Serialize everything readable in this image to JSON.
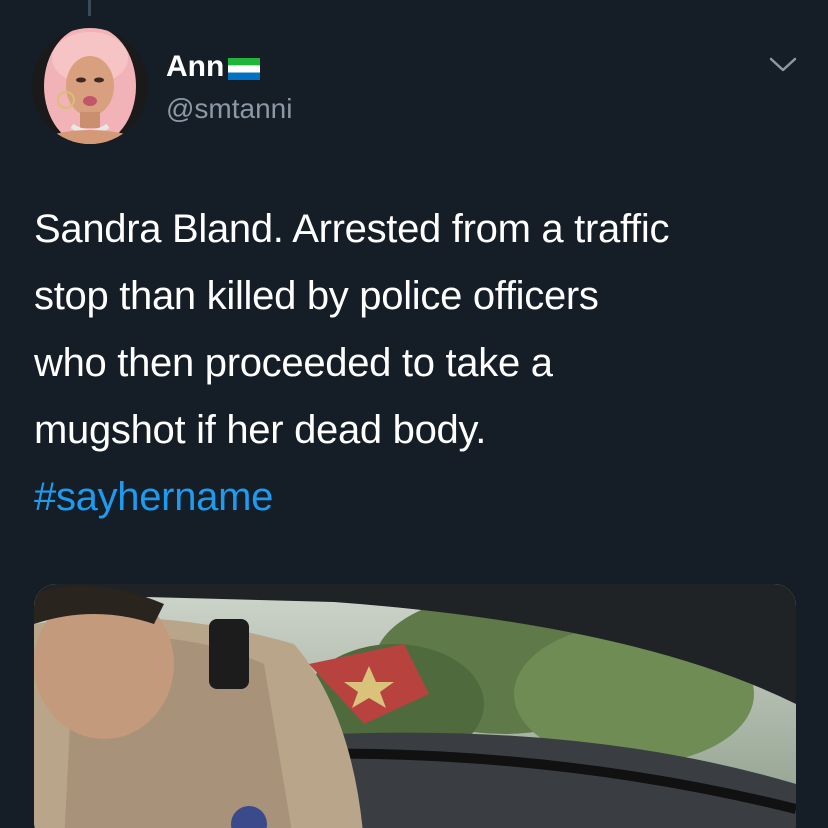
{
  "tweet": {
    "display_name": "Ann",
    "handle": "@smtanni",
    "text_lines": [
      "Sandra Bland. Arrested from a traffic",
      "stop than killed by police officers",
      "who then proceeded to take a",
      "mugshot if her dead body."
    ],
    "hashtag": "#sayhername",
    "icons": {
      "flag": "sierra-leone-flag-icon",
      "menu": "chevron-down-icon"
    }
  },
  "colors": {
    "background": "#151d26",
    "text": "#ffffff",
    "secondary": "#8b98a5",
    "link": "#1d9bf0"
  }
}
